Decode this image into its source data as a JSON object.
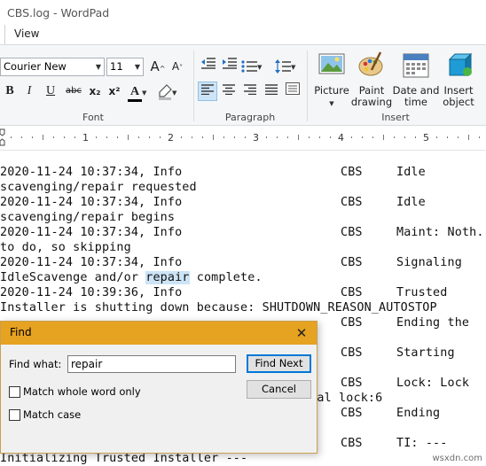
{
  "window": {
    "title": "CBS.log - WordPad"
  },
  "menu": {
    "view": "View"
  },
  "ribbon": {
    "font_name": "Courier New",
    "font_size": "11",
    "groups": {
      "font": "Font",
      "paragraph": "Paragraph",
      "insert": "Insert"
    },
    "insert_buttons": {
      "picture": "Picture",
      "paint_drawing_1": "Paint",
      "paint_drawing_2": "drawing",
      "date_time_1": "Date and",
      "date_time_2": "time",
      "insert_object_1": "Insert",
      "insert_object_2": "object"
    },
    "format_glyphs": {
      "bold": "B",
      "italic": "I",
      "underline": "U",
      "strike": "abc",
      "subscript": "x₂",
      "superscript": "x²",
      "color": "A"
    }
  },
  "ruler": {
    "numbers": [
      "1",
      "2",
      "3",
      "4",
      "5"
    ]
  },
  "document": {
    "lines": [
      {
        "a": "2020-11-24 10:37:34, Info",
        "b": "CBS",
        "c": "Idle"
      },
      {
        "a": "scavenging/repair requested",
        "b": "",
        "c": ""
      },
      {
        "a": "2020-11-24 10:37:34, Info",
        "b": "CBS",
        "c": "Idle"
      },
      {
        "a": "scavenging/repair begins",
        "b": "",
        "c": ""
      },
      {
        "a": "2020-11-24 10:37:34, Info",
        "b": "CBS",
        "c": "Maint: Noth."
      },
      {
        "a": "to do, so skipping",
        "b": "",
        "c": ""
      },
      {
        "a": "2020-11-24 10:37:34, Info",
        "b": "CBS",
        "c": "Signaling"
      },
      {
        "a": "IdleScavenge and/or",
        "hl": "repair",
        "a2": "complete.",
        "b": "",
        "c": ""
      },
      {
        "a": "2020-11-24 10:39:36, Info",
        "b": "CBS",
        "c": "Trusted"
      },
      {
        "a": "Installer is shutting down because: SHUTDOWN_REASON_AUTOSTOP",
        "b": "",
        "c": ""
      },
      {
        "a": "",
        "b": "CBS",
        "c": "Ending the"
      },
      {
        "a": "",
        "b": "",
        "c": ""
      },
      {
        "a": "",
        "b": "CBS",
        "c": "Starting"
      },
      {
        "a": "",
        "b": "",
        "c": ""
      },
      {
        "a": "",
        "b": "CBS",
        "c": "Lock: Lock"
      },
      {
        "a": "",
        "b": "otal lock:6",
        "c": ""
      },
      {
        "a": "",
        "b": "CBS",
        "c": "Ending"
      },
      {
        "a": "",
        "b": "",
        "c": ""
      },
      {
        "a": "",
        "b": "CBS",
        "c": "TI: ---"
      },
      {
        "a": "Initializing Trusted Installer ---",
        "b": "",
        "c": ""
      }
    ]
  },
  "find_dialog": {
    "title": "Find",
    "find_what_label": "Find what:",
    "find_what_value": "repair",
    "find_next": "Find Next",
    "cancel": "Cancel",
    "match_whole_word": "Match whole word only",
    "match_case": "Match case"
  },
  "watermark": "wsxdn.com",
  "colors": {
    "dialog_title": "#e6a221",
    "selection": "#cce4f6",
    "ribbon_bg": "#f5f6f7"
  }
}
